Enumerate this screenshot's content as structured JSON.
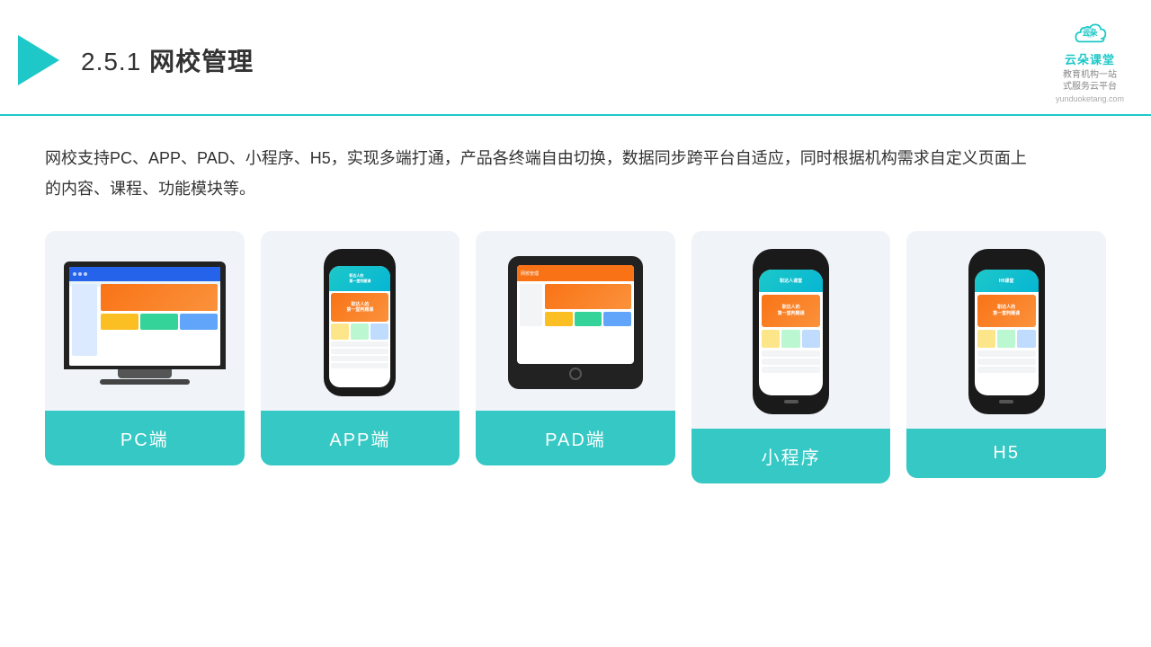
{
  "header": {
    "section_number": "2.5.1",
    "title": "网校管理",
    "brand_name": "云朵课堂",
    "brand_url": "yunduoketang.com",
    "brand_slogan_line1": "教育机构一站",
    "brand_slogan_line2": "式服务云平台"
  },
  "description": "网校支持PC、APP、PAD、小程序、H5，实现多端打通，产品各终端自由切换，数据同步跨平台自适应，同时根据机构需求自定义页面上的内容、课程、功能模块等。",
  "devices": [
    {
      "id": "pc",
      "label": "PC端"
    },
    {
      "id": "app",
      "label": "APP端"
    },
    {
      "id": "pad",
      "label": "PAD端"
    },
    {
      "id": "miniprogram",
      "label": "小程序"
    },
    {
      "id": "h5",
      "label": "H5"
    }
  ],
  "colors": {
    "accent": "#1ec8c8",
    "card_label_bg": "#36c8c4",
    "header_border": "#1ec8c8"
  }
}
